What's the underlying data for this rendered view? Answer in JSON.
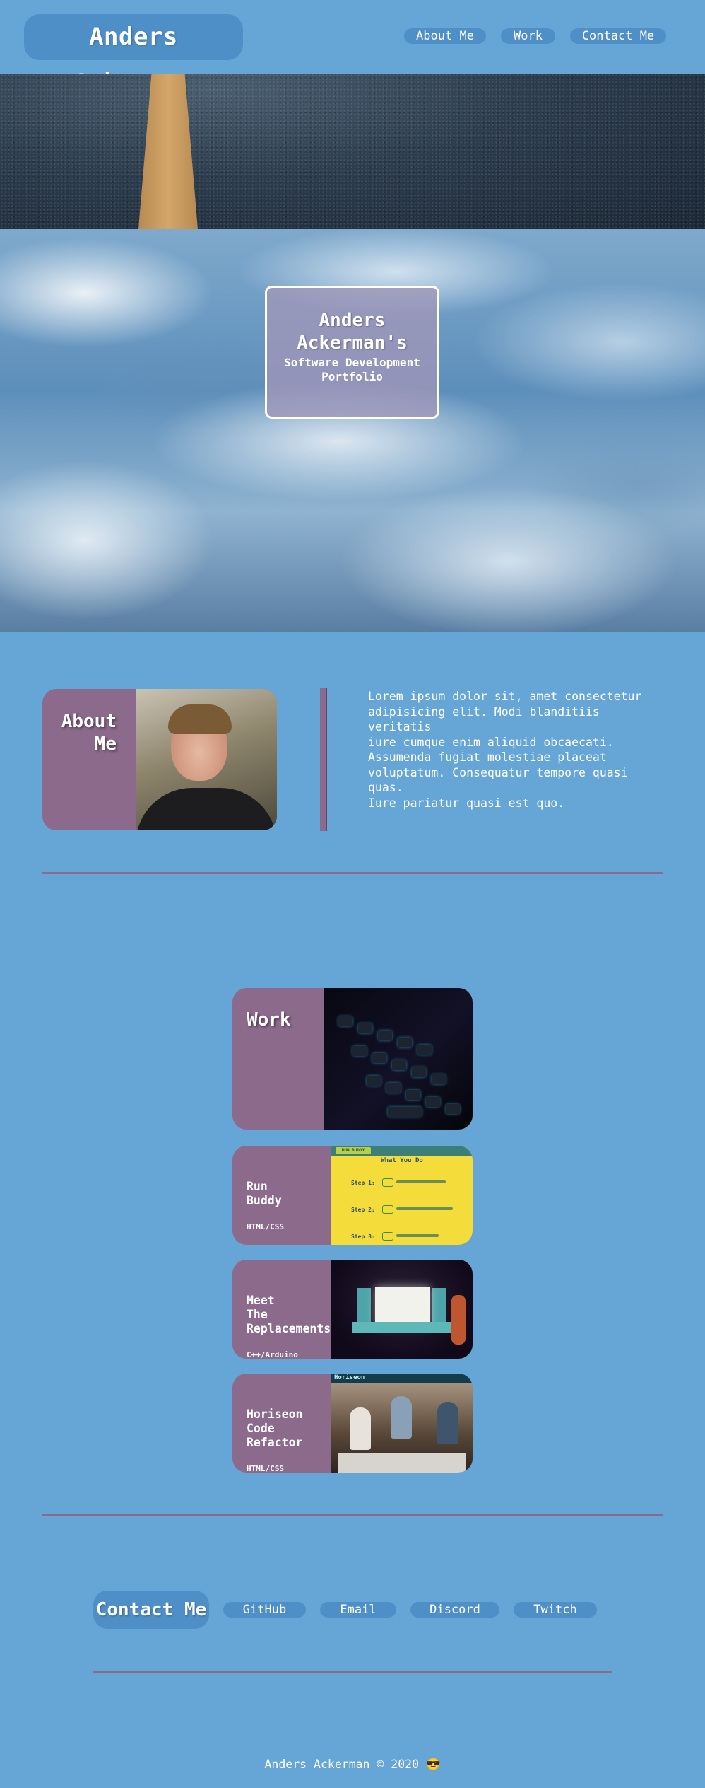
{
  "header": {
    "brand": "Anders Ackerman",
    "nav": [
      {
        "label": "About Me"
      },
      {
        "label": "Work"
      },
      {
        "label": "Contact Me"
      }
    ]
  },
  "hero": {
    "title": "Anders Ackerman's",
    "subtitle": "Software Development Portfolio"
  },
  "about": {
    "label": "About Me",
    "text": "Lorem ipsum dolor sit, amet consectetur\nadipisicing elit. Modi blanditiis veritatis\niure cumque enim aliquid obcaecati.\nAssumenda fugiat molestiae placeat\nvoluptatum. Consequatur tempore quasi quas.\nIure pariatur quasi est quo."
  },
  "work": {
    "label": "Work",
    "projects": [
      {
        "title": "Run\nBuddy",
        "tag": "HTML/CSS",
        "screenshot": {
          "app_name": "RUN BUDDY",
          "heading": "What You Do",
          "steps": [
            "Step 1:",
            "Step 2:",
            "Step 3:"
          ]
        }
      },
      {
        "title": "Meet\nThe\nReplacements",
        "tag": "C++/Arduino"
      },
      {
        "title": "Horiseon\nCode\nRefactor",
        "tag": "HTML/CSS",
        "screenshot": {
          "brand": "Horiseon"
        }
      }
    ]
  },
  "contact": {
    "label": "Contact Me",
    "links": [
      {
        "label": "GitHub"
      },
      {
        "label": "Email"
      },
      {
        "label": "Discord"
      },
      {
        "label": "Twitch"
      }
    ]
  },
  "footer": {
    "text": "Anders Ackerman © 2020 😎"
  },
  "colors": {
    "background": "#66a6d6",
    "pill": "#4f8fc8",
    "accent": "#8b6a8b"
  }
}
